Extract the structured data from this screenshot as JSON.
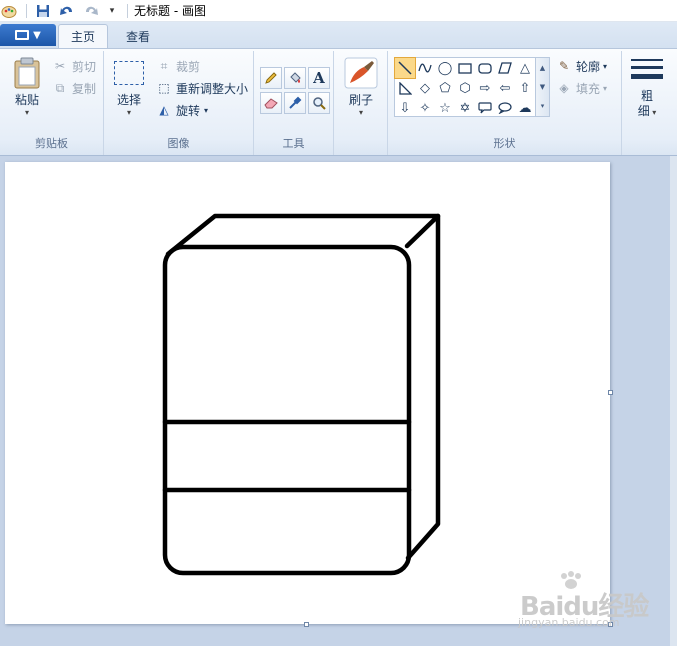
{
  "window": {
    "title": "无标题 - 画图"
  },
  "tabs": [
    {
      "label": "主页",
      "active": true
    },
    {
      "label": "查看",
      "active": false
    }
  ],
  "clipboard": {
    "group_label": "剪贴板",
    "paste_label": "粘贴",
    "cut_label": "剪切",
    "copy_label": "复制"
  },
  "image": {
    "group_label": "图像",
    "select_label": "选择",
    "crop_label": "裁剪",
    "resize_label": "重新调整大小",
    "rotate_label": "旋转"
  },
  "tools": {
    "group_label": "工具",
    "items": [
      "pencil-icon",
      "fill-bucket-icon",
      "text-icon",
      "eraser-icon",
      "color-picker-icon",
      "magnifier-icon"
    ]
  },
  "brushes": {
    "label": "刷子"
  },
  "shapes": {
    "group_label": "形状",
    "outline_label": "轮廓",
    "fill_label": "填充",
    "items": [
      "line",
      "curve",
      "oval",
      "rectangle",
      "rounded-rectangle",
      "polygon",
      "triangle",
      "right-triangle",
      "diamond",
      "pentagon",
      "hexagon",
      "right-arrow",
      "left-arrow",
      "up-arrow",
      "down-arrow",
      "four-point-star",
      "five-point-star",
      "six-point-star",
      "rounded-callout",
      "oval-callout",
      "cloud-callout"
    ],
    "selected": "line"
  },
  "size": {
    "label_top": "粗",
    "label_bottom": "细"
  },
  "watermark": {
    "brand": "Baidu经验",
    "url": "jingyan.baidu.com"
  },
  "colors": {
    "ribbon_text": "#1e395b",
    "canvas_bg": "#ffffff",
    "workspace_bg": "#c5d3e7",
    "selection": "#fbd98a"
  }
}
